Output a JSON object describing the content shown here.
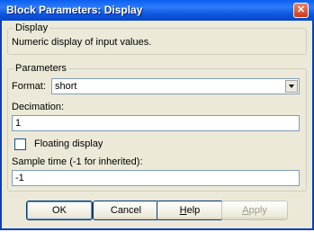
{
  "window": {
    "title": "Block Parameters: Display",
    "close_glyph": "✕"
  },
  "display_group": {
    "legend": "Display",
    "description": "Numeric display of input values."
  },
  "parameters_group": {
    "legend": "Parameters",
    "format_label": "Format:",
    "format_value": "short",
    "decimation_label": "Decimation:",
    "decimation_value": "1",
    "floating_label": "Floating display",
    "floating_checked": false,
    "sample_time_label": "Sample time (-1 for inherited):",
    "sample_time_value": "-1"
  },
  "buttons": {
    "ok": "OK",
    "cancel": "Cancel",
    "help_first": "H",
    "help_rest": "elp",
    "apply_first": "A",
    "apply_rest": "pply"
  },
  "colors": {
    "titlebar": "#0a5ff2",
    "dialog_bg": "#ece9d8",
    "close_button": "#cb3a1a"
  }
}
